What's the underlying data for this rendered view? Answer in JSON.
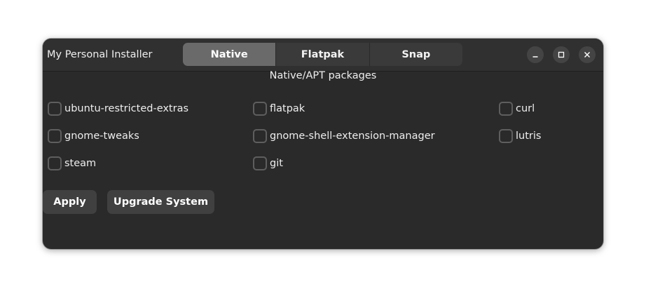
{
  "window": {
    "title": "My Personal Installer",
    "controls": {
      "minimize_icon": "minimize-icon",
      "maximize_icon": "maximize-icon",
      "close_icon": "close-icon"
    }
  },
  "tabs": [
    {
      "label": "Native",
      "active": true
    },
    {
      "label": "Flatpak",
      "active": false
    },
    {
      "label": "Snap",
      "active": false
    }
  ],
  "page": {
    "heading": "Native/APT packages"
  },
  "packages": [
    {
      "label": "ubuntu-restricted-extras",
      "checked": false
    },
    {
      "label": "flatpak",
      "checked": false
    },
    {
      "label": "curl",
      "checked": false
    },
    {
      "label": "gnome-tweaks",
      "checked": false
    },
    {
      "label": "gnome-shell-extension-manager",
      "checked": false
    },
    {
      "label": "lutris",
      "checked": false
    },
    {
      "label": "steam",
      "checked": false
    },
    {
      "label": "git",
      "checked": false
    }
  ],
  "actions": {
    "apply_label": "Apply",
    "upgrade_label": "Upgrade System"
  },
  "colors": {
    "window_bg": "#2a2a2a",
    "headerbar_bg": "#303030",
    "active_tab_bg": "#6a6a6a",
    "button_bg": "#404040"
  }
}
